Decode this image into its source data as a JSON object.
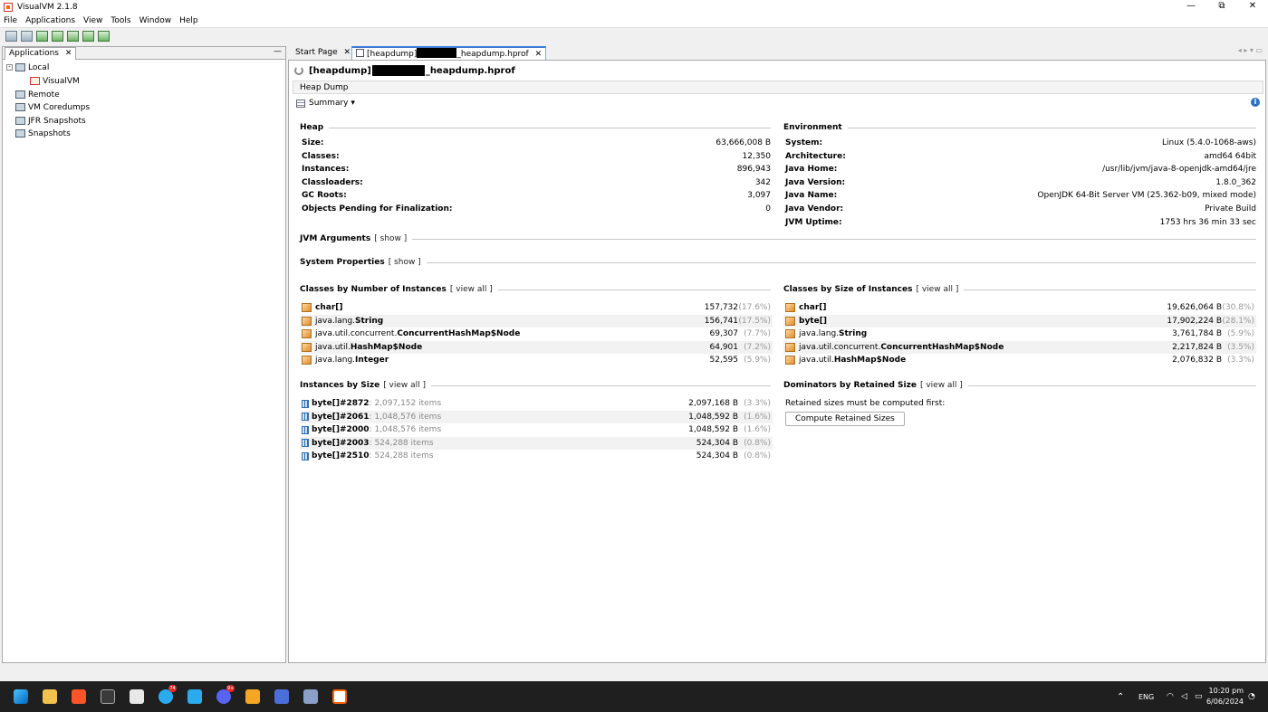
{
  "window": {
    "title": "VisualVM 2.1.8",
    "controls": [
      "—",
      "⧉",
      "✕"
    ]
  },
  "menu": [
    "File",
    "Applications",
    "View",
    "Tools",
    "Window",
    "Help"
  ],
  "left_panel": {
    "tab_label": "Applications",
    "close": "✕",
    "minimize": "—",
    "tree": [
      "Local",
      "VisualVM",
      "Remote",
      "VM Coredumps",
      "JFR Snapshots",
      "Snapshots"
    ]
  },
  "tabs": {
    "start_page": "Start Page",
    "close": "✕",
    "heapdump_prefix": "[heapdump]",
    "heapdump_suffix": "_heapdump.hprof",
    "nav": "◂ ▸ ▾ ▭"
  },
  "content": {
    "header_prefix": "[heapdump]",
    "header_suffix": "_heapdump.hprof",
    "subheader": "Heap Dump",
    "summary_label": "Summary ▾",
    "info": "i"
  },
  "heap": {
    "title": "Heap",
    "rows": [
      {
        "k": "Size:",
        "v": "63,666,008 B"
      },
      {
        "k": "Classes:",
        "v": "12,350"
      },
      {
        "k": "Instances:",
        "v": "896,943"
      },
      {
        "k": "Classloaders:",
        "v": "342"
      },
      {
        "k": "GC Roots:",
        "v": "3,097"
      },
      {
        "k": "Objects Pending for Finalization:",
        "v": "0"
      }
    ]
  },
  "environment": {
    "title": "Environment",
    "rows": [
      {
        "k": "System:",
        "v": "Linux (5.4.0-1068-aws)"
      },
      {
        "k": "Architecture:",
        "v": "amd64 64bit"
      },
      {
        "k": "Java Home:",
        "v": "/usr/lib/jvm/java-8-openjdk-amd64/jre"
      },
      {
        "k": "Java Version:",
        "v": "1.8.0_362"
      },
      {
        "k": "Java Name:",
        "v": "OpenJDK 64-Bit Server VM (25.362-b09, mixed mode)"
      },
      {
        "k": "Java Vendor:",
        "v": "Private Build"
      },
      {
        "k": "JVM Uptime:",
        "v": "1753 hrs 36 min 33 sec"
      }
    ]
  },
  "jvm_args": {
    "title": "JVM Arguments",
    "link": "[ show ]"
  },
  "sys_props": {
    "title": "System Properties",
    "link": "[ show ]"
  },
  "classes_by_number": {
    "title": "Classes by Number of Instances",
    "link": "[ view all ]",
    "rows": [
      {
        "pkg": "",
        "cls": "char[]",
        "val": "157,732",
        "pct": "(17.6%)"
      },
      {
        "pkg": "java.lang.",
        "cls": "String",
        "val": "156,741",
        "pct": "(17.5%)"
      },
      {
        "pkg": "java.util.concurrent.",
        "cls": "ConcurrentHashMap$Node",
        "val": "69,307",
        "pct": "(7.7%)"
      },
      {
        "pkg": "java.util.",
        "cls": "HashMap$Node",
        "val": "64,901",
        "pct": "(7.2%)"
      },
      {
        "pkg": "java.lang.",
        "cls": "Integer",
        "val": "52,595",
        "pct": "(5.9%)"
      }
    ]
  },
  "classes_by_size": {
    "title": "Classes by Size of Instances",
    "link": "[ view all ]",
    "rows": [
      {
        "pkg": "",
        "cls": "char[]",
        "val": "19,626,064 B",
        "pct": "(30.8%)"
      },
      {
        "pkg": "",
        "cls": "byte[]",
        "val": "17,902,224 B",
        "pct": "(28.1%)"
      },
      {
        "pkg": "java.lang.",
        "cls": "String",
        "val": "3,761,784 B",
        "pct": "(5.9%)"
      },
      {
        "pkg": "java.util.concurrent.",
        "cls": "ConcurrentHashMap$Node",
        "val": "2,217,824 B",
        "pct": "(3.5%)"
      },
      {
        "pkg": "java.util.",
        "cls": "HashMap$Node",
        "val": "2,076,832 B",
        "pct": "(3.3%)"
      }
    ]
  },
  "instances_by_size": {
    "title": "Instances by Size",
    "link": "[ view all ]",
    "rows": [
      {
        "name": "byte[]#2872",
        "items": " : 2,097,152 items",
        "val": "2,097,168 B",
        "pct": "(3.3%)"
      },
      {
        "name": "byte[]#2061",
        "items": " : 1,048,576 items",
        "val": "1,048,592 B",
        "pct": "(1.6%)"
      },
      {
        "name": "byte[]#2000",
        "items": " : 1,048,576 items",
        "val": "1,048,592 B",
        "pct": "(1.6%)"
      },
      {
        "name": "byte[]#2003",
        "items": " : 524,288 items",
        "val": "524,304 B",
        "pct": "(0.8%)"
      },
      {
        "name": "byte[]#2510",
        "items": " : 524,288 items",
        "val": "524,304 B",
        "pct": "(0.8%)"
      }
    ]
  },
  "dominators": {
    "title": "Dominators by Retained Size",
    "link": "[ view all ]",
    "note": "Retained sizes must be computed first:",
    "button": "Compute Retained Sizes"
  },
  "taskbar": {
    "badges": [
      "74",
      "9+"
    ],
    "tray_lang": "ENG",
    "tray_icons": "⌃",
    "time": "10:20 pm",
    "date": "6/06/2024"
  }
}
